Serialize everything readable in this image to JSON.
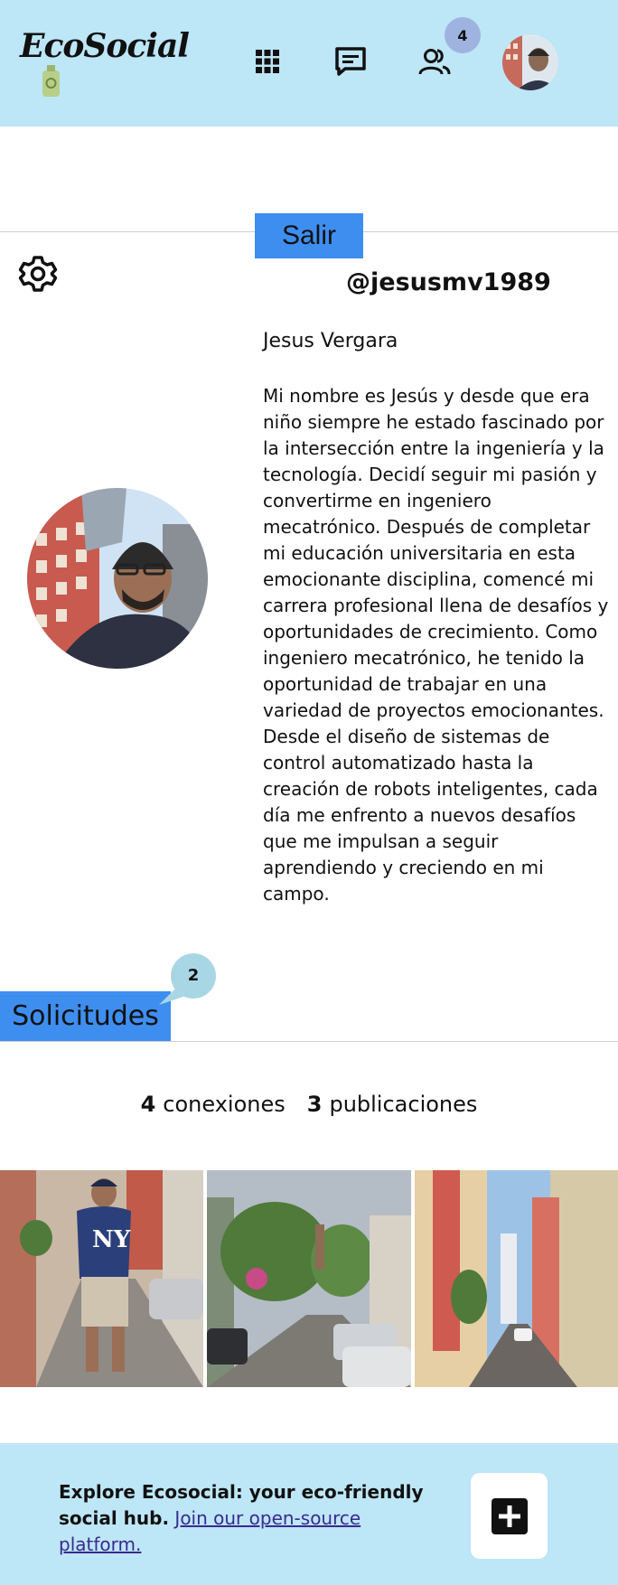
{
  "header": {
    "logo_text": "EcoSocial",
    "nav": [
      {
        "icon": "apps-grid-icon"
      },
      {
        "icon": "message-icon"
      },
      {
        "icon": "people-icon"
      }
    ],
    "notification_count": "4"
  },
  "profile": {
    "logout_label": "Salir",
    "username": "@jesusmv1989",
    "full_name": "Jesus Vergara",
    "bio": "Mi nombre es Jesús y desde que era niño siempre he estado fascinado por la intersección entre la ingeniería y la tecnología. Decidí seguir mi pasión y convertirme en ingeniero mecatrónico. Después de completar mi educación universitaria en esta emocionante disciplina, comencé mi carrera profesional llena de desafíos y oportunidades de crecimiento. Como ingeniero mecatrónico, he tenido la oportunidad de trabajar en una variedad de proyectos emocionantes. Desde el diseño de sistemas de control automatizado hasta la creación de robots inteligentes, cada día me enfrento a nuevos desafíos que me impulsan a seguir aprendiendo y creciendo en mi campo."
  },
  "requests": {
    "label": "Solicitudes",
    "count": "2"
  },
  "stats": {
    "connections_count": "4",
    "connections_label": "conexiones",
    "posts_count": "3",
    "posts_label": "publicaciones"
  },
  "footer": {
    "text_bold": "Explore Ecosocial: your eco-friendly social hub.",
    "link_text": "Join our open-source platform."
  },
  "colors": {
    "header_bg": "#bde6f7",
    "accent_blue": "#3e8ef0",
    "badge": "#9fb3e0"
  }
}
